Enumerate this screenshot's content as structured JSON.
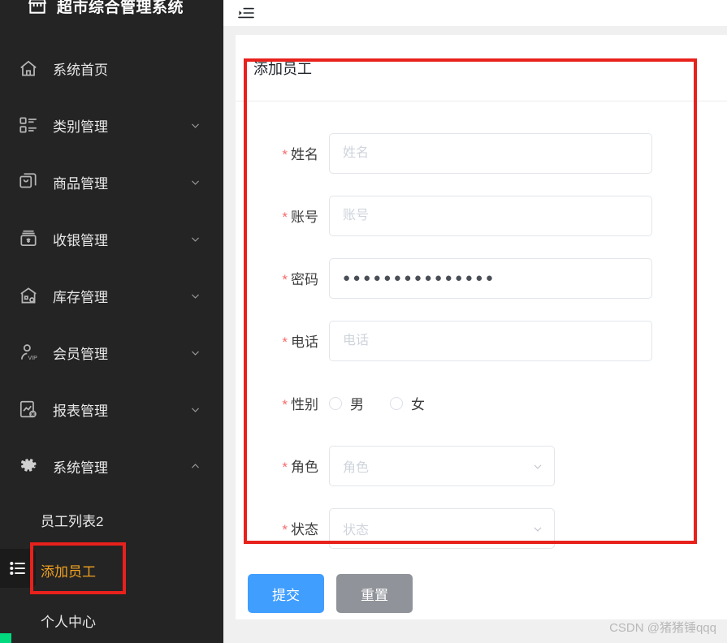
{
  "sidebar": {
    "brand": {
      "logo_icon": "shop-icon",
      "title": "超市综合管理系统"
    },
    "items": [
      {
        "icon": "home-icon",
        "label": "系统首页",
        "chevron": ""
      },
      {
        "icon": "category-icon",
        "label": "类别管理",
        "chevron": "down"
      },
      {
        "icon": "goods-icon",
        "label": "商品管理",
        "chevron": "down"
      },
      {
        "icon": "cashier-icon",
        "label": "收银管理",
        "chevron": "down"
      },
      {
        "icon": "warehouse-icon",
        "label": "库存管理",
        "chevron": "down"
      },
      {
        "icon": "vip-icon",
        "label": "会员管理",
        "chevron": "down"
      },
      {
        "icon": "report-icon",
        "label": "报表管理",
        "chevron": "down"
      },
      {
        "icon": "gear-icon",
        "label": "系统管理",
        "chevron": "up"
      }
    ],
    "subitems": [
      {
        "label": "员工列表2",
        "active": false
      },
      {
        "label": "添加员工",
        "active": true
      },
      {
        "label": "个人中心",
        "active": false
      }
    ],
    "edge_tab_icon": "list-icon",
    "bg_color": "#242424",
    "active_color": "#f0a020"
  },
  "topbar": {
    "fold_icon": "menu-fold-icon"
  },
  "card": {
    "title": "添加员工"
  },
  "form": {
    "fields": [
      {
        "name": "姓名",
        "required": true,
        "type": "text",
        "value": "",
        "placeholder": "姓名"
      },
      {
        "name": "账号",
        "required": true,
        "type": "text",
        "value": "",
        "placeholder": "账号"
      },
      {
        "name": "密码",
        "required": true,
        "type": "password",
        "value": "●●●●●●●●●●●●●●●",
        "placeholder": "密码"
      },
      {
        "name": "电话",
        "required": true,
        "type": "text",
        "value": "",
        "placeholder": "电话"
      },
      {
        "name": "性别",
        "required": true,
        "type": "radio",
        "value": "",
        "placeholder": ""
      },
      {
        "name": "角色",
        "required": true,
        "type": "select",
        "value": "",
        "placeholder": "角色"
      },
      {
        "name": "状态",
        "required": true,
        "type": "select",
        "value": "",
        "placeholder": "状态"
      }
    ],
    "gender_options": [
      {
        "label": "男",
        "checked": false
      },
      {
        "label": "女",
        "checked": false
      }
    ],
    "required_marker": "*"
  },
  "buttons": {
    "submit": "提交",
    "reset": "重置",
    "submit_color": "#409eff",
    "reset_color": "#909399"
  },
  "annotation": {
    "color": "#e8211c"
  },
  "watermark": {
    "text": "CSDN @猪猪锤qqq"
  }
}
